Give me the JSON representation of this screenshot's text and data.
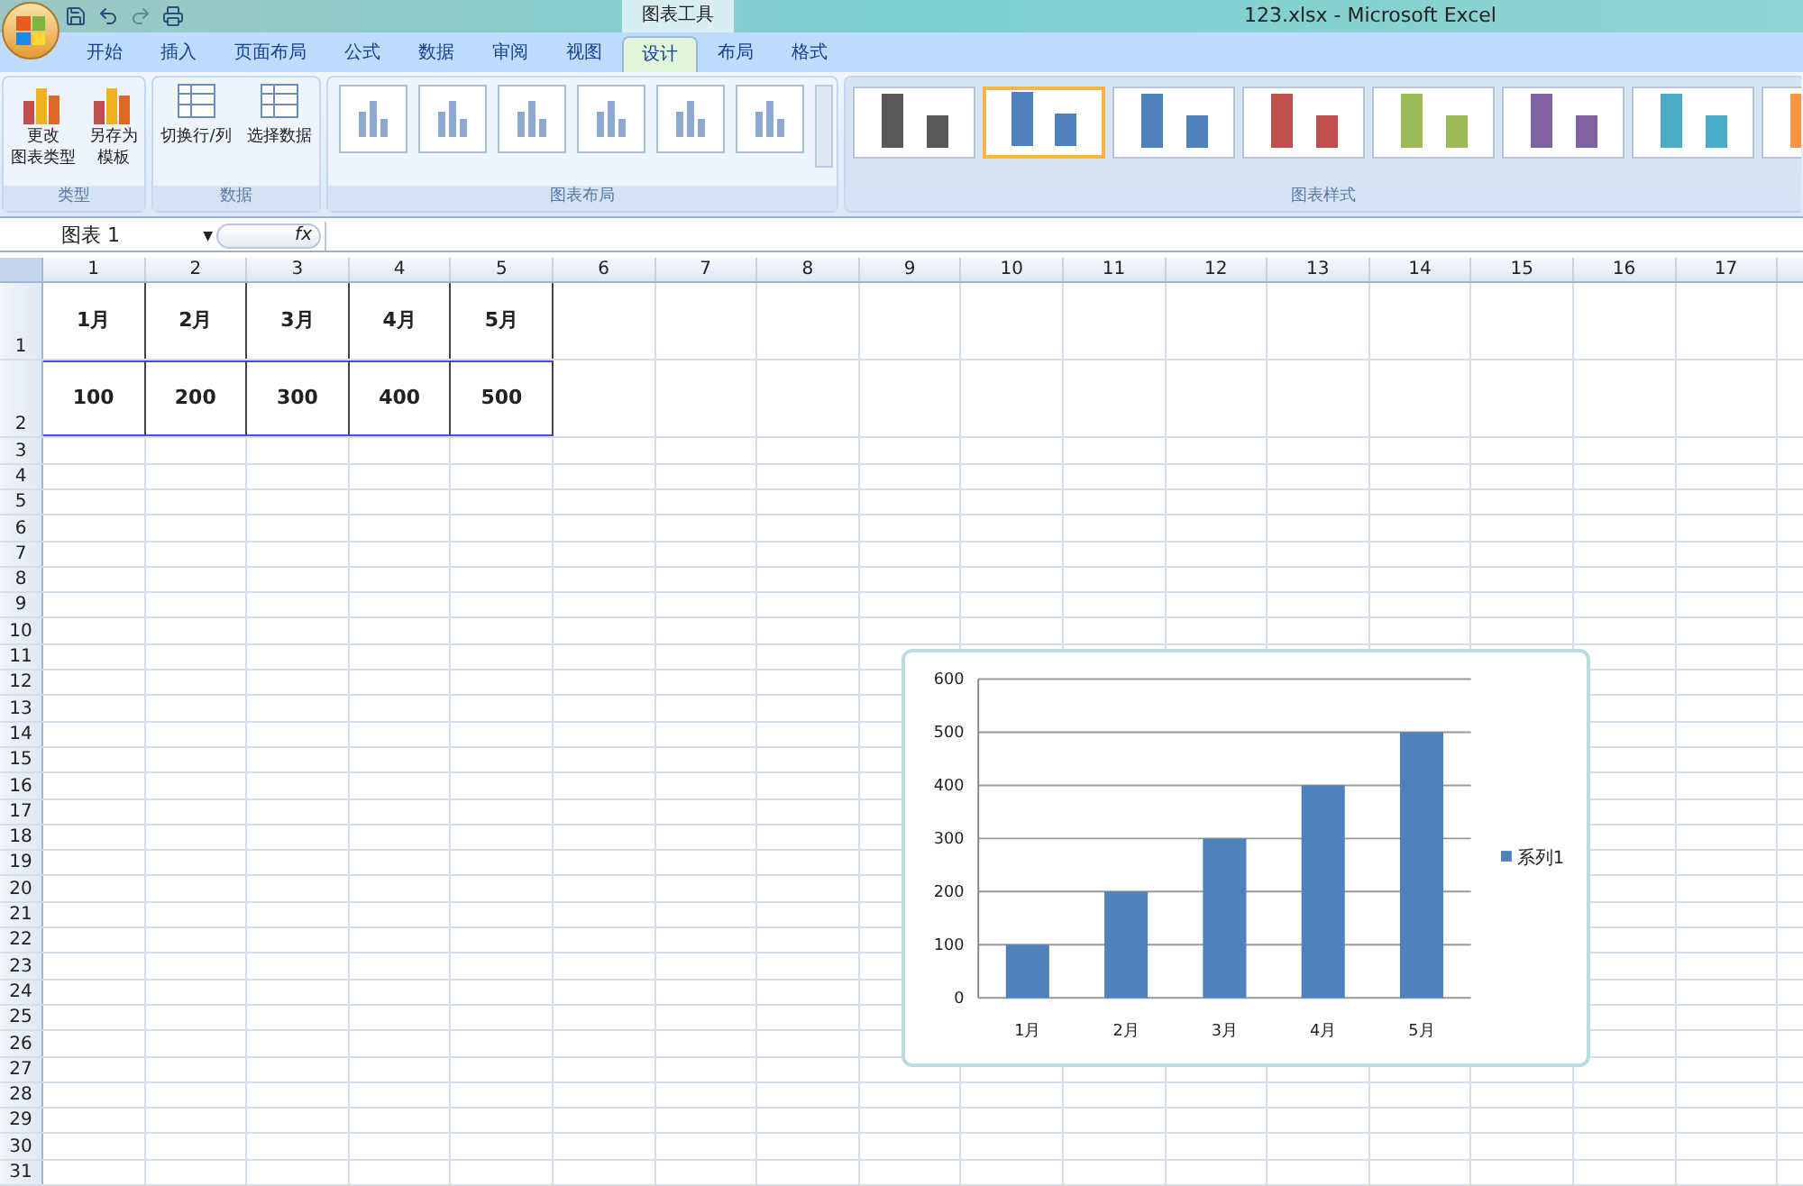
{
  "window": {
    "title": "123.xlsx - Microsoft Excel",
    "context_tab_group": "图表工具"
  },
  "tabs": [
    {
      "label": "开始",
      "selected": false
    },
    {
      "label": "插入",
      "selected": false
    },
    {
      "label": "页面布局",
      "selected": false
    },
    {
      "label": "公式",
      "selected": false
    },
    {
      "label": "数据",
      "selected": false
    },
    {
      "label": "审阅",
      "selected": false
    },
    {
      "label": "视图",
      "selected": false
    },
    {
      "label": "设计",
      "selected": true
    },
    {
      "label": "布局",
      "selected": false
    },
    {
      "label": "格式",
      "selected": false
    }
  ],
  "ribbon": {
    "type_group": {
      "label": "类型",
      "buttons": [
        {
          "lines": [
            "更改",
            "图表类型"
          ]
        },
        {
          "lines": [
            "另存为",
            "模板"
          ]
        }
      ]
    },
    "data_group": {
      "label": "数据",
      "buttons": [
        {
          "label": "切换行/列"
        },
        {
          "label": "选择数据"
        }
      ]
    },
    "layout_group": {
      "label": "图表布局"
    },
    "style_group": {
      "label": "图表样式",
      "styles": [
        {
          "color": "#595959",
          "selected": false
        },
        {
          "color": "#4f81bd",
          "selected": true
        },
        {
          "color": "#4f81bd",
          "selected": false
        },
        {
          "color": "#c0504d",
          "selected": false
        },
        {
          "color": "#9bbb59",
          "selected": false
        },
        {
          "color": "#8064a2",
          "selected": false
        },
        {
          "color": "#4bacc6",
          "selected": false
        },
        {
          "color": "#f79646",
          "selected": false
        }
      ]
    }
  },
  "formula_bar": {
    "name_box": "图表 1",
    "dropdown": "▼",
    "fx": "fx"
  },
  "sheet": {
    "columns": [
      "1",
      "2",
      "3",
      "4",
      "5",
      "6",
      "7",
      "8",
      "9",
      "10",
      "11",
      "12",
      "13",
      "14",
      "15",
      "16",
      "17"
    ],
    "rows": [
      "1",
      "2",
      "3",
      "4",
      "5",
      "6",
      "7",
      "8",
      "9",
      "10",
      "11",
      "12",
      "13",
      "14",
      "15",
      "16",
      "17",
      "18",
      "19",
      "20",
      "21",
      "22",
      "23",
      "24",
      "25",
      "26",
      "27",
      "28",
      "29",
      "30",
      "31"
    ],
    "cells": [
      [
        "1月",
        "2月",
        "3月",
        "4月",
        "5月"
      ],
      [
        "100",
        "200",
        "300",
        "400",
        "500"
      ]
    ]
  },
  "chart": {
    "chart_data": {
      "type": "bar",
      "categories": [
        "1月",
        "2月",
        "3月",
        "4月",
        "5月"
      ],
      "series": [
        {
          "name": "系列1",
          "color": "#4f81bd",
          "values": [
            100,
            200,
            300,
            400,
            500
          ]
        }
      ],
      "ylim": [
        0,
        600
      ],
      "grid": true,
      "yticks": [
        0,
        100,
        200,
        300,
        400,
        500,
        600
      ]
    }
  }
}
